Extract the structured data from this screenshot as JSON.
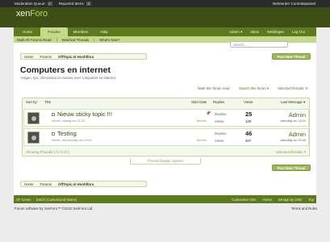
{
  "admin_bar": {
    "moderation_label": "Moderation Queue:",
    "moderation_count": "0",
    "reported_label": "Reported Items:",
    "reported_count": "0",
    "control_panel": "Beheerder Controlepaneel"
  },
  "logo": {
    "part1": "xen",
    "part2": "Foro"
  },
  "nav": {
    "tabs": [
      "Home",
      "Forums",
      "Members",
      "Help"
    ],
    "active_tab": "Forums",
    "right": [
      "Admin ▾",
      "Inbox",
      "Meldingen",
      "Log Out"
    ]
  },
  "subnav": [
    "Mark All Forums Read",
    "Watched Threads",
    "What's New?"
  ],
  "breadcrumbs": [
    "Home",
    "Forums",
    "OffTopic.nl Hoofdfora"
  ],
  "search": {
    "placeholder": "Search..."
  },
  "buttons": {
    "post_new_thread": "Post New Thread"
  },
  "forum": {
    "title": "Computers en internet",
    "description": "Vragen, tips, discussies en nieuws over computers en internet.",
    "mark_read": "Mark this forum read",
    "search_forum": "Search this forum ▾",
    "selected_threads": "Selected threads: 0"
  },
  "table": {
    "headers": {
      "sort_by": "Sort by:",
      "title": "Title",
      "start_date": "Start Date",
      "replies": "Replies",
      "views": "Views",
      "last_message": "Last Message ▾"
    },
    "threads": [
      {
        "title": "Nieuw sticky topic !!!",
        "meta": "Admin, vrijdag om 04:33",
        "link": "Beheer",
        "replies_label": "Replies:",
        "views_label": "Views:",
        "replies": "25",
        "views": "129",
        "last_user": "Admin",
        "last_date": "zaterdag om 18:01",
        "sticky": true
      },
      {
        "title": "Testing",
        "meta": "Admin, Wednesday om 23:00",
        "link": "Beheer",
        "replies_label": "Replies:",
        "views_label": "Views:",
        "replies": "46",
        "views": "207",
        "last_user": "Admin",
        "last_date": "zaterdag om 03:36",
        "sticky": false
      }
    ],
    "footer_left": "Showing Threads 1 to 2 of 2",
    "footer_right": "Selected threads: 0"
  },
  "thread_tools": "Thread Display Options",
  "footer": {
    "left": [
      "XF Green",
      "Dutch (Customized Name)"
    ],
    "right": [
      "Contacteer Ons",
      "Home",
      "Design by DXB",
      "Top"
    ]
  },
  "copyright": "Forum software by XenForo™ ©2010 XenForo Ltd.",
  "terms": "Terms and Rules",
  "colors": {
    "header": "#3d4f14",
    "nav": "#5e7a1e",
    "accent": "#9cb85a",
    "tab_active": "#c4d98a"
  }
}
